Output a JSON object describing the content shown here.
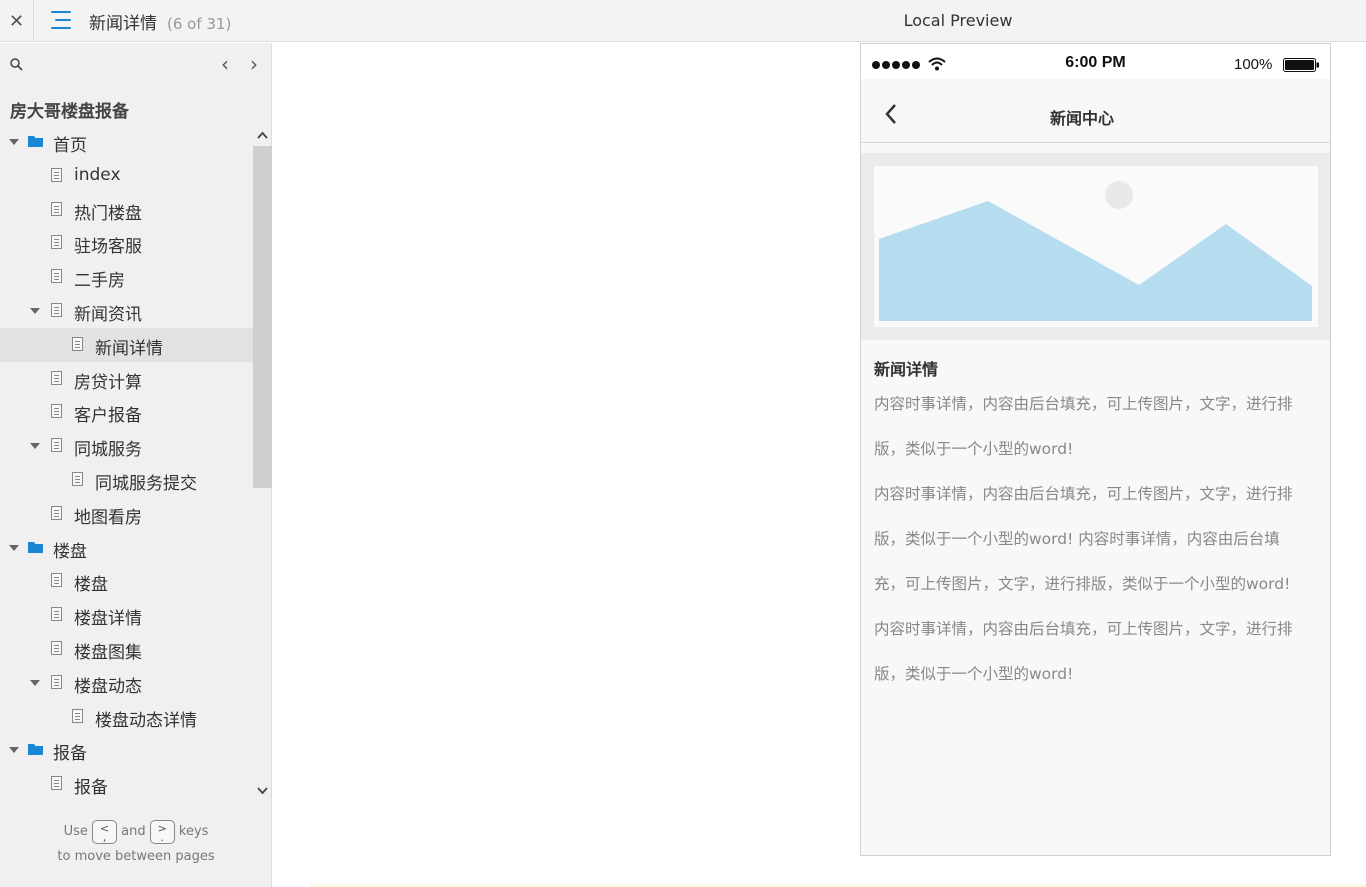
{
  "topbar": {
    "close_glyph": "✕",
    "page_title": "新闻详情",
    "page_count": "(6 of 31)",
    "preview_title": "Local Preview"
  },
  "sidebar": {
    "nav_prev_glyph": "‹",
    "nav_next_glyph": "›",
    "project_title": "房大哥楼盘报备",
    "tree": [
      {
        "label": "首页",
        "type": "folder",
        "expanded": true
      },
      {
        "label": "index",
        "type": "page"
      },
      {
        "label": "热门楼盘",
        "type": "page"
      },
      {
        "label": "驻场客服",
        "type": "page"
      },
      {
        "label": "二手房",
        "type": "page"
      },
      {
        "label": "新闻资讯",
        "type": "page",
        "expanded": true
      },
      {
        "label": "新闻详情",
        "type": "page",
        "selected": true
      },
      {
        "label": "房贷计算",
        "type": "page"
      },
      {
        "label": "客户报备",
        "type": "page"
      },
      {
        "label": "同城服务",
        "type": "page",
        "expanded": true
      },
      {
        "label": "同城服务提交",
        "type": "page"
      },
      {
        "label": "地图看房",
        "type": "page"
      },
      {
        "label": "楼盘",
        "type": "folder",
        "expanded": true
      },
      {
        "label": "楼盘",
        "type": "page"
      },
      {
        "label": "楼盘详情",
        "type": "page"
      },
      {
        "label": "楼盘图集",
        "type": "page"
      },
      {
        "label": "楼盘动态",
        "type": "page",
        "expanded": true
      },
      {
        "label": "楼盘动态详情",
        "type": "page"
      },
      {
        "label": "报备",
        "type": "folder",
        "expanded": true
      },
      {
        "label": "报备",
        "type": "page"
      }
    ],
    "hint": {
      "use": "Use",
      "key_prev": "<\n,",
      "and": "and",
      "key_next": ">\n.",
      "keys": "keys",
      "line2": "to move between pages"
    }
  },
  "phone": {
    "status_time": "6:00 PM",
    "battery_text": "100%",
    "nav_title": "新闻中心",
    "article_title": "新闻详情",
    "paragraph1": "内容时事详情，内容由后台填充，可上传图片，文字，进行排版，类似于一个小型的word!",
    "paragraph2": "内容时事详情，内容由后台填充，可上传图片，文字，进行排版，类似于一个小型的word! 内容时事详情，内容由后台填充，可上传图片，文字，进行排版，类似于一个小型的word! 内容时事详情，内容由后台填充，可上传图片，文字，进行排版，类似于一个小型的word!"
  },
  "colors": {
    "accent": "#1a87d6",
    "placeholder_mountain": "#b5dcef",
    "placeholder_sun": "#e8e8e8"
  }
}
